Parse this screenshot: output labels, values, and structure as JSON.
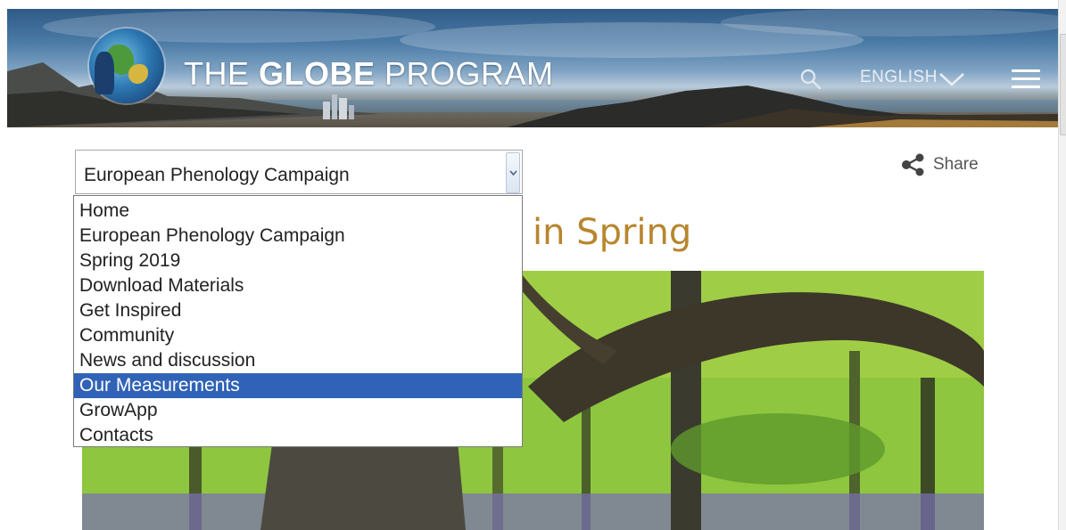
{
  "header": {
    "brand_the": "THE ",
    "brand_globe": "GLOBE",
    "brand_program": " PROGRAM",
    "language": "ENGLISH",
    "icons": [
      "logo",
      "search-icon",
      "chevron-down-icon",
      "hamburger-menu-icon"
    ]
  },
  "share": {
    "label": "Share",
    "icon": "share-icon"
  },
  "page": {
    "title_visible": "in Spring"
  },
  "select": {
    "value": "European Phenology Campaign",
    "options": [
      "Home",
      "European Phenology Campaign",
      "Spring 2019",
      "Download Materials",
      "Get Inspired",
      "Community",
      "News and discussion",
      "Our Measurements",
      "GrowApp",
      "Contacts"
    ],
    "highlighted": "Our Measurements"
  },
  "colors": {
    "highlight": "#3063b7",
    "title": "#b8862f"
  }
}
